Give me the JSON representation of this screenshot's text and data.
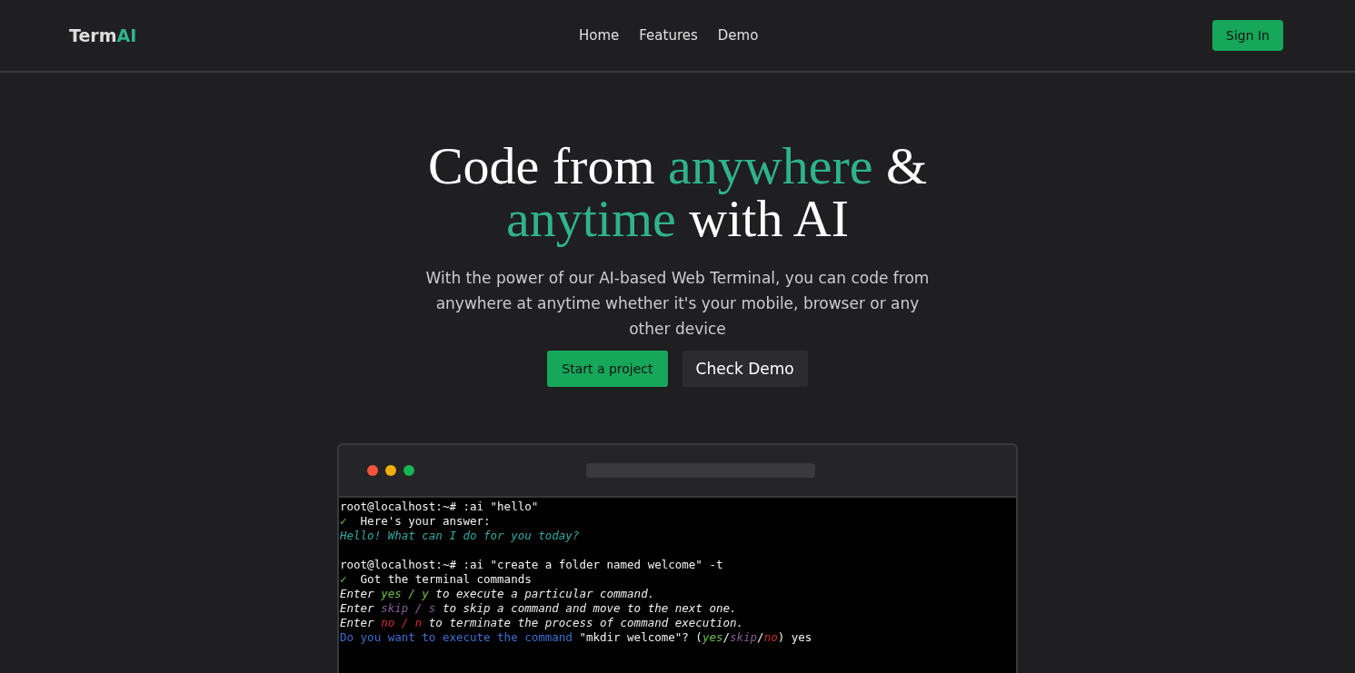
{
  "brand": [
    {
      "text": "Term",
      "accent": false
    },
    {
      "text": "AI",
      "accent": true
    }
  ],
  "nav": [
    {
      "label": "Home"
    },
    {
      "label": "Features"
    },
    {
      "label": "Demo"
    }
  ],
  "sign_in": "Sign In",
  "hero": {
    "title_lines": [
      [
        {
          "text": "Code from ",
          "accent": false
        },
        {
          "text": "anywhere",
          "accent": true
        },
        {
          "text": " &",
          "accent": false
        }
      ],
      [
        {
          "text": "anytime",
          "accent": true
        },
        {
          "text": " with AI",
          "accent": false
        }
      ]
    ],
    "subtitle": "With the power of our AI-based Web Terminal, you can code from anywhere at anytime whether it's your mobile, browser or any other device",
    "primary_button": "Start a project",
    "secondary_button": "Check Demo"
  },
  "terminal": {
    "lines": [
      {
        "segments": [
          {
            "kind": "plain",
            "text": "root@localhost:~# :ai \"hello\""
          }
        ]
      },
      {
        "segments": [
          {
            "kind": "check",
            "text": "✓"
          },
          {
            "kind": "plain",
            "text": "  Here's your answer:"
          }
        ]
      },
      {
        "segments": [
          {
            "kind": "answer",
            "text": "Hello! What can I do for you today?"
          }
        ]
      },
      {
        "kind": "blank"
      },
      {
        "segments": [
          {
            "kind": "plain",
            "text": "root@localhost:~# :ai \"create a folder named welcome\" -t"
          }
        ]
      },
      {
        "segments": [
          {
            "kind": "check",
            "text": "✓"
          },
          {
            "kind": "plain",
            "text": "  Got the terminal commands"
          }
        ]
      },
      {
        "segments": [
          {
            "kind": "hint",
            "text": "Enter "
          },
          {
            "kind": "yes",
            "text": "yes / y"
          },
          {
            "kind": "hint",
            "text": " to execute a particular command."
          }
        ]
      },
      {
        "segments": [
          {
            "kind": "hint",
            "text": "Enter "
          },
          {
            "kind": "skip",
            "text": "skip / s"
          },
          {
            "kind": "hint",
            "text": " to skip a command and move to the next one."
          }
        ]
      },
      {
        "segments": [
          {
            "kind": "hint",
            "text": "Enter "
          },
          {
            "kind": "no",
            "text": "no / n"
          },
          {
            "kind": "hint",
            "text": " to terminate the process of command execution."
          }
        ]
      },
      {
        "segments": [
          {
            "kind": "question",
            "text": "Do you want to execute the command"
          },
          {
            "kind": "plain",
            "text": " \"mkdir welcome\"? ("
          },
          {
            "kind": "yes",
            "text": "yes"
          },
          {
            "kind": "plain",
            "text": "/"
          },
          {
            "kind": "skip",
            "text": "skip"
          },
          {
            "kind": "plain",
            "text": "/"
          },
          {
            "kind": "no",
            "text": "no"
          },
          {
            "kind": "plain",
            "text": ") yes"
          }
        ]
      }
    ]
  }
}
